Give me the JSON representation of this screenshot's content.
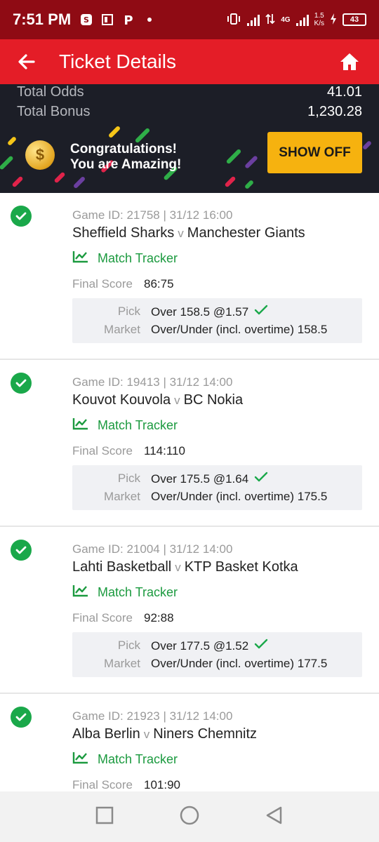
{
  "status": {
    "time": "7:51 PM",
    "network": "4G",
    "speed_value": "1.5",
    "speed_unit": "K/s",
    "battery": "43"
  },
  "header": {
    "title": "Ticket Details"
  },
  "summary": {
    "total_odds_label": "Total Odds",
    "total_odds_value": "41.01",
    "total_bonus_label": "Total Bonus",
    "total_bonus_value": "1,230.28"
  },
  "promo": {
    "line1": "Congratulations!",
    "line2": "You are Amazing!",
    "button": "SHOW OFF",
    "coin_symbol": "$"
  },
  "labels": {
    "tracker": "Match Tracker",
    "final_score": "Final Score",
    "pick": "Pick",
    "market": "Market",
    "vs": "v"
  },
  "bets": [
    {
      "game_id": "Game ID: 21758 | 31/12 16:00",
      "home": "Sheffield Sharks",
      "away": "Manchester Giants",
      "score": "86:75",
      "pick": "Over 158.5 @1.57",
      "market": "Over/Under (incl. overtime) 158.5"
    },
    {
      "game_id": "Game ID: 19413 | 31/12 14:00",
      "home": "Kouvot Kouvola",
      "away": "BC Nokia",
      "score": "114:110",
      "pick": "Over 175.5 @1.64",
      "market": "Over/Under (incl. overtime) 175.5"
    },
    {
      "game_id": "Game ID: 21004 | 31/12 14:00",
      "home": "Lahti Basketball",
      "away": "KTP Basket Kotka",
      "score": "92:88",
      "pick": "Over 177.5 @1.52",
      "market": "Over/Under (incl. overtime) 177.5"
    },
    {
      "game_id": "Game ID: 21923 | 31/12 14:00",
      "home": "Alba Berlin",
      "away": "Niners Chemnitz",
      "score": "101:90",
      "pick": "",
      "market": ""
    }
  ],
  "colors": {
    "status_bar": "#8f0b14",
    "app_bar": "#e41d27",
    "accent_green": "#1aa84a",
    "show_off": "#f6b20f"
  }
}
